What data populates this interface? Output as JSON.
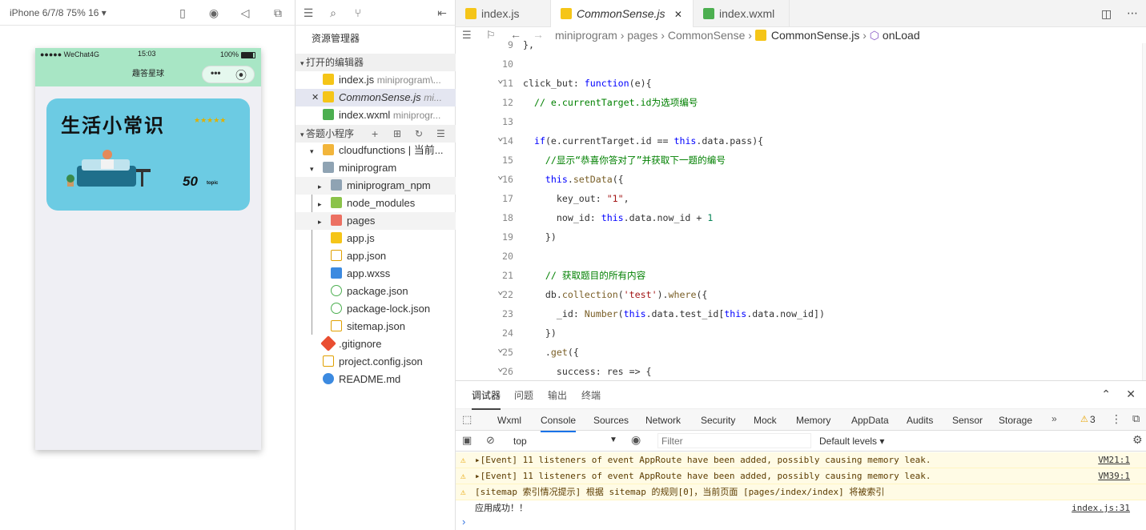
{
  "simulator": {
    "device": "iPhone 6/7/8 75% 16 ▾",
    "status_left": "●●●●● WeChat4G",
    "status_time": "15:03",
    "status_battery": "100%",
    "nav_title": "趣答星球",
    "card_title": "生活小常识",
    "card_stars": "★★★★★",
    "card_count": "50",
    "card_count_label": "topic"
  },
  "explorer": {
    "title": "资源管理器",
    "open_editors_label": "打开的编辑器",
    "project_label": "答题小程序",
    "open_editors": [
      {
        "name": "index.js",
        "path": "miniprogram\\...",
        "icon": "js"
      },
      {
        "name": "CommonSense.js",
        "path": "mi...",
        "icon": "js"
      },
      {
        "name": "index.wxml",
        "path": "miniprogr...",
        "icon": "wxml"
      }
    ],
    "tree": [
      {
        "name": "cloudfunctions | 当前...",
        "indent": 1,
        "arrow": "▾",
        "icon": "folder-yellow"
      },
      {
        "name": "miniprogram",
        "indent": 1,
        "arrow": "▾",
        "icon": "folder"
      },
      {
        "name": "miniprogram_npm",
        "indent": 2,
        "arrow": "▸",
        "icon": "folder"
      },
      {
        "name": "node_modules",
        "indent": 2,
        "arrow": "▸",
        "icon": "folder-green"
      },
      {
        "name": "pages",
        "indent": 2,
        "arrow": "▸",
        "icon": "folder-red"
      },
      {
        "name": "app.js",
        "indent": 2,
        "arrow": "",
        "icon": "js"
      },
      {
        "name": "app.json",
        "indent": 2,
        "arrow": "",
        "icon": "json"
      },
      {
        "name": "app.wxss",
        "indent": 2,
        "arrow": "",
        "icon": "css"
      },
      {
        "name": "package.json",
        "indent": 2,
        "arrow": "",
        "icon": "npm"
      },
      {
        "name": "package-lock.json",
        "indent": 2,
        "arrow": "",
        "icon": "npm"
      },
      {
        "name": "sitemap.json",
        "indent": 2,
        "arrow": "",
        "icon": "json"
      },
      {
        "name": ".gitignore",
        "indent": 1,
        "arrow": "",
        "icon": "git"
      },
      {
        "name": "project.config.json",
        "indent": 1,
        "arrow": "",
        "icon": "json"
      },
      {
        "name": "README.md",
        "indent": 1,
        "arrow": "",
        "icon": "info"
      }
    ]
  },
  "editor": {
    "tabs": [
      "index.js",
      "CommonSense.js",
      "index.wxml"
    ],
    "breadcrumb": [
      "miniprogram",
      "pages",
      "CommonSense",
      "CommonSense.js",
      "onLoad"
    ],
    "lines": [
      {
        "n": "9",
        "code": "},"
      },
      {
        "n": "10",
        "code": ""
      },
      {
        "n": "11",
        "code": "click_but: function(e){"
      },
      {
        "n": "12",
        "code": "  // e.currentTarget.id为选项编号"
      },
      {
        "n": "13",
        "code": ""
      },
      {
        "n": "14",
        "code": "  if(e.currentTarget.id == this.data.pass){"
      },
      {
        "n": "15",
        "code": "    //显示“恭喜你答对了”并获取下一题的编号"
      },
      {
        "n": "16",
        "code": "    this.setData({"
      },
      {
        "n": "17",
        "code": "      key_out: \"1\","
      },
      {
        "n": "18",
        "code": "      now_id: this.data.now_id + 1"
      },
      {
        "n": "19",
        "code": "    })"
      },
      {
        "n": "20",
        "code": ""
      },
      {
        "n": "21",
        "code": "    // 获取题目的所有内容"
      },
      {
        "n": "22",
        "code": "    db.collection('test').where({"
      },
      {
        "n": "23",
        "code": "      _id: Number(this.data.test_id[this.data.now_id])"
      },
      {
        "n": "24",
        "code": "    })"
      },
      {
        "n": "25",
        "code": "    .get({"
      },
      {
        "n": "26",
        "code": "      success: res => {"
      }
    ]
  },
  "console": {
    "top_tabs": [
      "调试器",
      "问题",
      "输出",
      "终端"
    ],
    "devtools_tabs": [
      "Wxml",
      "Console",
      "Sources",
      "Network",
      "Security",
      "Mock",
      "Memory",
      "AppData",
      "Audits",
      "Sensor",
      "Storage"
    ],
    "warn_count": "3",
    "context": "top",
    "filter_placeholder": "Filter",
    "levels": "Default levels ▾",
    "messages": [
      {
        "type": "warn",
        "text": "▸[Event] 11 listeners of event AppRoute have been added, possibly causing memory leak.",
        "src": "VM21:1"
      },
      {
        "type": "warn",
        "text": "▸[Event] 11 listeners of event AppRoute have been added, possibly causing memory leak.",
        "src": "VM39:1"
      },
      {
        "type": "warn",
        "text": "[sitemap 索引情况提示] 根据 sitemap 的规则[0]，当前页面 [pages/index/index] 将被索引",
        "src": ""
      },
      {
        "type": "log",
        "text": "应用成功！！",
        "src": "index.js:31"
      }
    ],
    "prompt": "›"
  }
}
